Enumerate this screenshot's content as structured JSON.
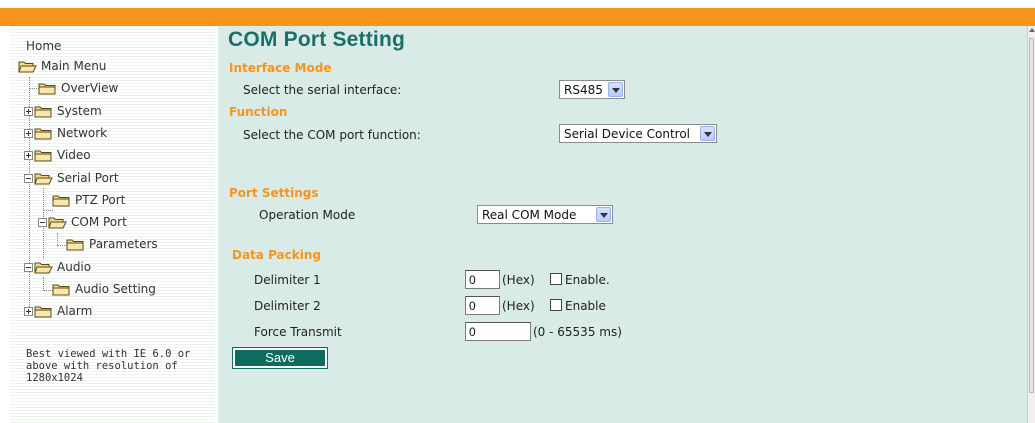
{
  "sidebar": {
    "home": "Home",
    "items": [
      {
        "label": "Main Menu"
      },
      {
        "label": "OverView"
      },
      {
        "label": "System"
      },
      {
        "label": "Network"
      },
      {
        "label": "Video"
      },
      {
        "label": "Serial Port"
      },
      {
        "label": "PTZ Port"
      },
      {
        "label": "COM Port"
      },
      {
        "label": "Parameters"
      },
      {
        "label": "Audio"
      },
      {
        "label": "Audio Setting"
      },
      {
        "label": "Alarm"
      }
    ],
    "note": "Best viewed with IE 6.0 or above with resolution of 1280x1024"
  },
  "page": {
    "title": "COM Port Setting"
  },
  "interface_mode": {
    "heading": "Interface Mode",
    "label": "Select the serial interface:",
    "value": "RS485"
  },
  "function": {
    "heading": "Function",
    "label": "Select the COM port function:",
    "value": "Serial Device Control"
  },
  "port_settings": {
    "heading": "Port Settings",
    "operation_mode_label": "Operation Mode",
    "operation_mode_value": "Real COM Mode"
  },
  "data_packing": {
    "heading": "Data Packing",
    "delimiter1": {
      "label": "Delimiter 1",
      "value": "0",
      "unit": "(Hex)",
      "enable_label": "Enable."
    },
    "delimiter2": {
      "label": "Delimiter 2",
      "value": "0",
      "unit": "(Hex)",
      "enable_label": "Enable"
    },
    "force_transmit": {
      "label": "Force Transmit",
      "value": "0",
      "range": "(0 - 65535 ms)"
    }
  },
  "actions": {
    "save_label": "Save"
  },
  "colors": {
    "accent": "#f7941d",
    "title": "#1b6f6b",
    "content_bg": "#d9ebe6",
    "button": "#0f6b5f"
  },
  "icons": {
    "folder": "folder-icon",
    "expand": "plus-box-icon",
    "collapse": "minus-box-icon"
  }
}
